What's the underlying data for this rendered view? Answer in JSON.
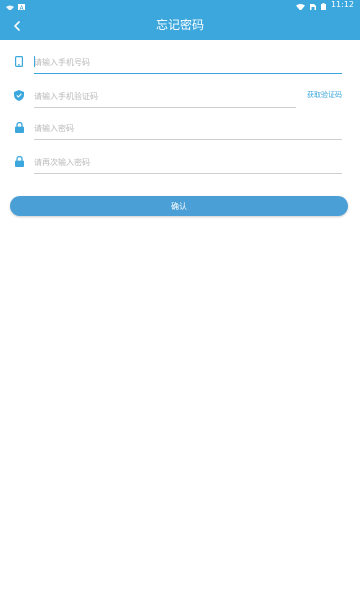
{
  "status_bar": {
    "time": "11:12",
    "icons": [
      "wifi-icon",
      "sim-icon",
      "battery-icon"
    ],
    "left_icons": [
      "notification-icon",
      "app-icon"
    ]
  },
  "header": {
    "title": "忘记密码",
    "back_icon": "chevron-left-icon"
  },
  "form": {
    "phone": {
      "placeholder": "请输入手机号码",
      "value": "",
      "icon": "phone-icon"
    },
    "code": {
      "placeholder": "请输入手机验证码",
      "value": "",
      "icon": "shield-check-icon",
      "action_label": "获取验证码"
    },
    "password": {
      "placeholder": "请输入密码",
      "value": "",
      "icon": "lock-icon"
    },
    "confirm_password": {
      "placeholder": "请再次输入密码",
      "value": "",
      "icon": "lock-icon"
    },
    "submit_label": "确认"
  },
  "colors": {
    "primary": "#3ba7dd",
    "button": "#4a9fd6",
    "divider": "#cfcfcf",
    "placeholder": "#b9b9b9"
  }
}
